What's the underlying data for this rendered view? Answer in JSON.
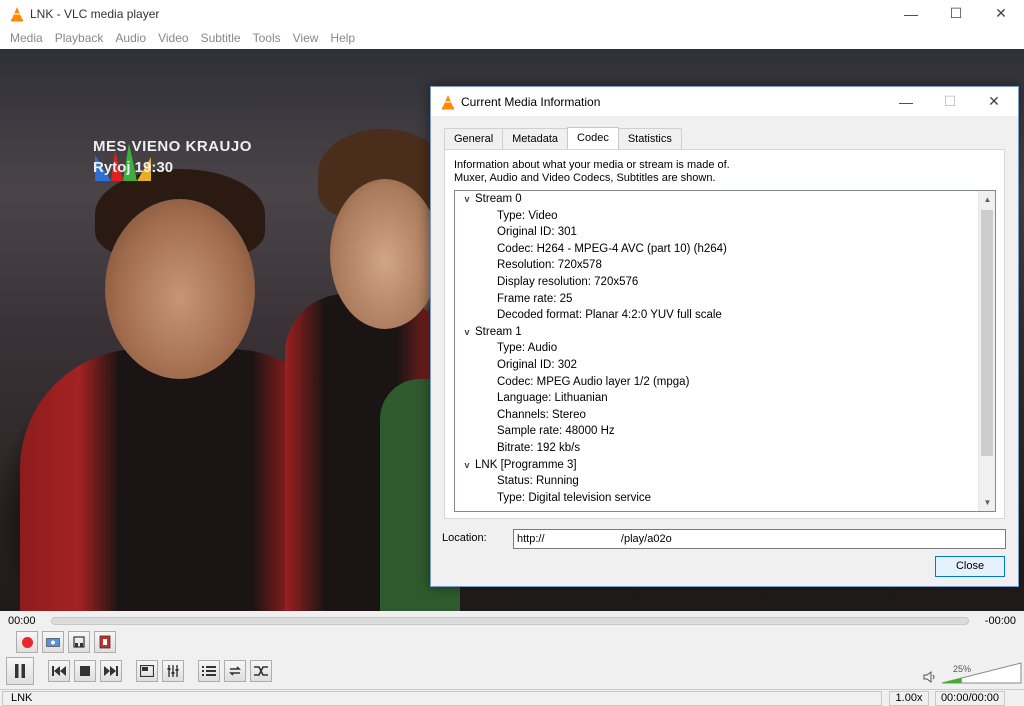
{
  "window": {
    "title": "LNK - VLC media player",
    "minimize": "—",
    "maximize": "☐",
    "close": "✕"
  },
  "menu": [
    "Media",
    "Playback",
    "Audio",
    "Video",
    "Subtitle",
    "Tools",
    "View",
    "Help"
  ],
  "video": {
    "osd_line1": "MES VIENO KRAUJO",
    "osd_line2": "Rytoj 19:30"
  },
  "dialog": {
    "title": "Current Media Information",
    "tabs": [
      "General",
      "Metadata",
      "Codec",
      "Statistics"
    ],
    "active_tab": "Codec",
    "description_line1": "Information about what your media or stream is made of.",
    "description_line2": "Muxer, Audio and Video Codecs, Subtitles are shown.",
    "tree": [
      {
        "label": "Stream 0",
        "expanded": true,
        "children": [
          "Type: Video",
          "Original ID: 301",
          "Codec: H264 - MPEG-4 AVC (part 10) (h264)",
          "Resolution: 720x578",
          "Display resolution: 720x576",
          "Frame rate: 25",
          "Decoded format: Planar 4:2:0 YUV full scale"
        ]
      },
      {
        "label": "Stream 1",
        "expanded": true,
        "children": [
          "Type: Audio",
          "Original ID: 302",
          "Codec: MPEG Audio layer 1/2 (mpga)",
          "Language: Lithuanian",
          "Channels: Stereo",
          "Sample rate: 48000 Hz",
          "Bitrate: 192 kb/s"
        ]
      },
      {
        "label": "LNK [Programme 3]",
        "expanded": true,
        "children": [
          "Status: Running",
          "Type: Digital television service"
        ]
      }
    ],
    "location_label": "Location:",
    "location_value": "http://                         /play/a02o",
    "close_label": "Close"
  },
  "playback": {
    "elapsed": "00:00",
    "remaining": "-00:00",
    "volume": "25%",
    "volume_level": 0.25
  },
  "status": {
    "label": "LNK",
    "speed": "1.00x",
    "duration": "00:00/00:00"
  },
  "colors": {
    "record": "#e8262c",
    "accent": "#0078d7",
    "volume": "#3fae2a",
    "vlc_orange": "#ff8800"
  }
}
